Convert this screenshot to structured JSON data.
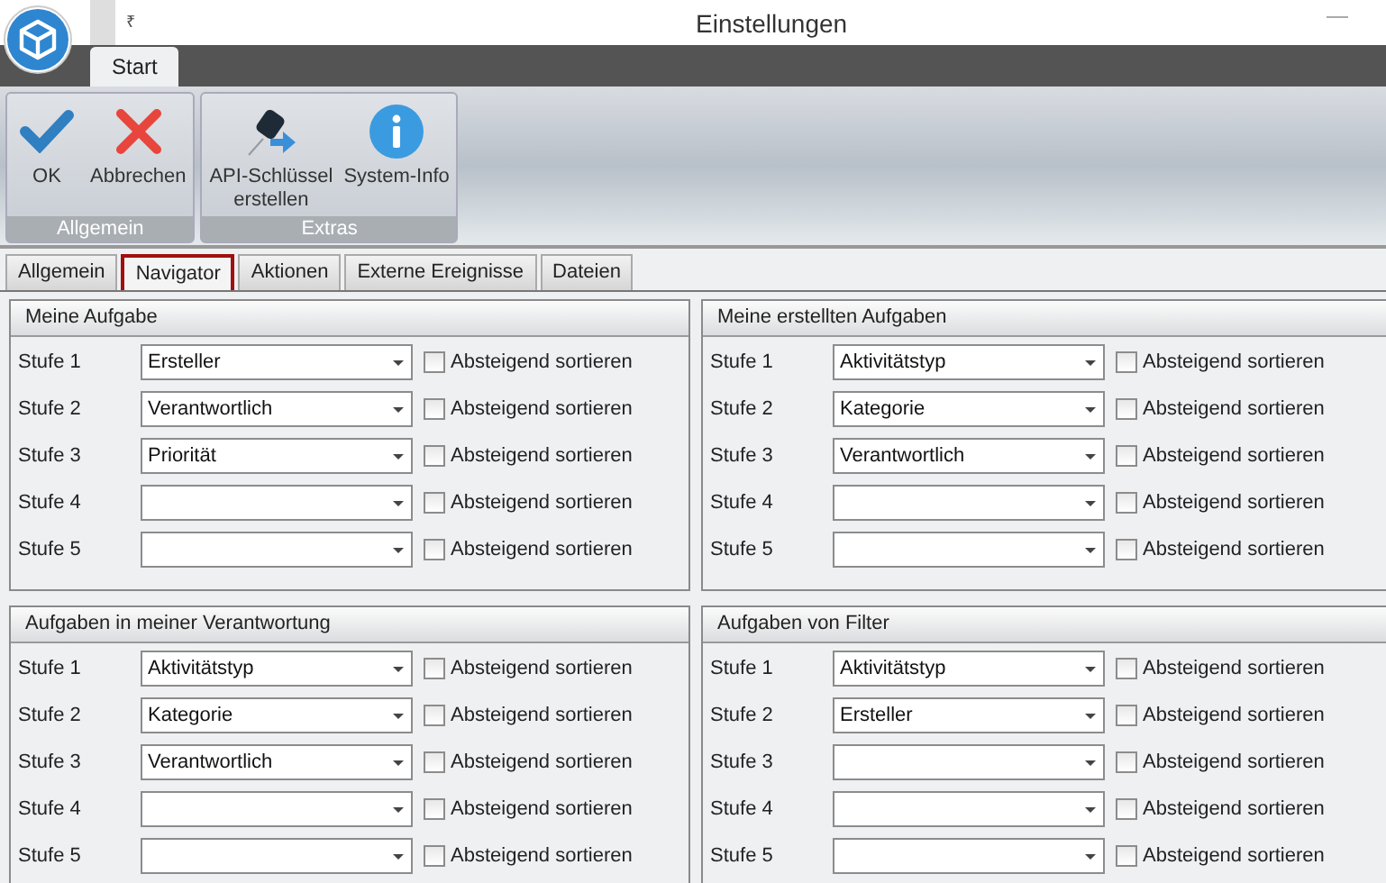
{
  "window": {
    "title": "Einstellungen",
    "quick_access": "₹"
  },
  "ribbon_tabs": [
    {
      "label": "Start",
      "selected": true
    }
  ],
  "ribbon_groups": [
    {
      "label": "Allgemein",
      "buttons": [
        {
          "label": "OK",
          "kind": "check"
        },
        {
          "label": "Abbrechen",
          "kind": "cross"
        }
      ]
    },
    {
      "label": "Extras",
      "buttons": [
        {
          "label": "API-Schlüssel\nerstellen",
          "kind": "key"
        },
        {
          "label": "System-Info",
          "kind": "info"
        }
      ]
    }
  ],
  "tabs": [
    {
      "label": "Allgemein",
      "selected": false
    },
    {
      "label": "Navigator",
      "selected": true
    },
    {
      "label": "Aktionen",
      "selected": false
    },
    {
      "label": "Externe Ereignisse",
      "selected": false
    },
    {
      "label": "Dateien",
      "selected": false
    }
  ],
  "panels": [
    {
      "title": "Meine Aufgabe",
      "rows": [
        {
          "label": "Stufe 1",
          "value": "Ersteller",
          "checkbox": "Absteigend sortieren",
          "checked": false
        },
        {
          "label": "Stufe 2",
          "value": "Verantwortlich",
          "checkbox": "Absteigend sortieren",
          "checked": false
        },
        {
          "label": "Stufe 3",
          "value": "Priorität",
          "checkbox": "Absteigend sortieren",
          "checked": false
        },
        {
          "label": "Stufe 4",
          "checkbox": "Absteigend sortieren",
          "checked": false
        },
        {
          "label": "Stufe 5",
          "checkbox": "Absteigend sortieren",
          "checked": false
        }
      ]
    },
    {
      "title": "Meine erstellten Aufgaben",
      "rows": [
        {
          "label": "Stufe 1",
          "value": "Aktivitätstyp",
          "checkbox": "Absteigend sortieren",
          "checked": false
        },
        {
          "label": "Stufe 2",
          "value": "Kategorie",
          "checkbox": "Absteigend sortieren",
          "checked": false
        },
        {
          "label": "Stufe 3",
          "value": "Verantwortlich",
          "checkbox": "Absteigend sortieren",
          "checked": false
        },
        {
          "label": "Stufe 4",
          "checkbox": "Absteigend sortieren",
          "checked": false
        },
        {
          "label": "Stufe 5",
          "checkbox": "Absteigend sortieren",
          "checked": false
        }
      ]
    },
    {
      "title": "Aufgaben in meiner Verantwortung",
      "rows": [
        {
          "label": "Stufe 1",
          "value": "Aktivitätstyp",
          "checkbox": "Absteigend sortieren",
          "checked": false
        },
        {
          "label": "Stufe 2",
          "value": "Kategorie",
          "checkbox": "Absteigend sortieren",
          "checked": false
        },
        {
          "label": "Stufe 3",
          "value": "Verantwortlich",
          "checkbox": "Absteigend sortieren",
          "checked": false
        },
        {
          "label": "Stufe 4",
          "checkbox": "Absteigend sortieren",
          "checked": false
        },
        {
          "label": "Stufe 5",
          "checkbox": "Absteigend sortieren",
          "checked": false
        }
      ]
    },
    {
      "title": "Aufgaben von Filter",
      "rows": [
        {
          "label": "Stufe 1",
          "value": "Aktivitätstyp",
          "checkbox": "Absteigend sortieren",
          "checked": false
        },
        {
          "label": "Stufe 2",
          "value": "Ersteller",
          "checkbox": "Absteigend sortieren",
          "checked": false
        },
        {
          "label": "Stufe 3",
          "checkbox": "Absteigend sortieren",
          "checked": false
        },
        {
          "label": "Stufe 4",
          "checkbox": "Absteigend sortieren",
          "checked": false
        },
        {
          "label": "Stufe 5",
          "checkbox": "Absteigend sortieren",
          "checked": false
        }
      ]
    }
  ]
}
